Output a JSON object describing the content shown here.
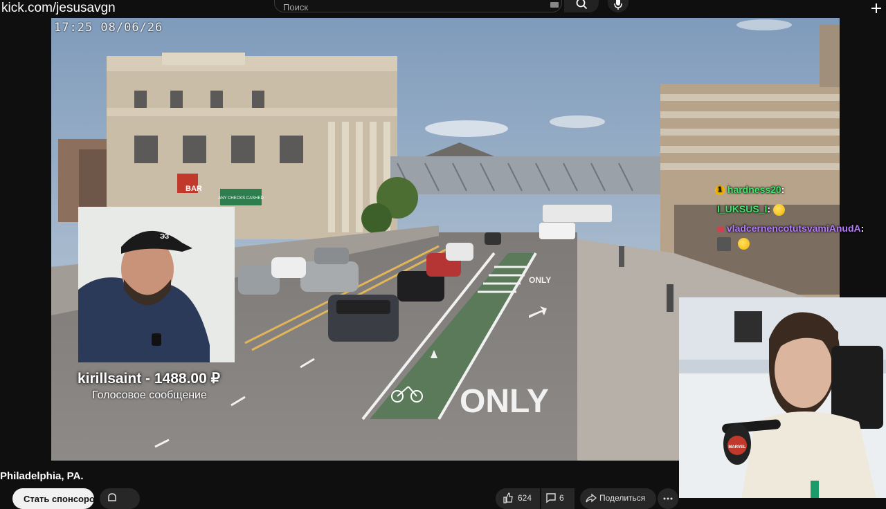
{
  "watermark": {
    "url": "kick.com/jesusavgn"
  },
  "header": {
    "search_placeholder": "Поиск",
    "icons": [
      "keyboard-icon",
      "search-icon",
      "mic-icon",
      "plus-icon"
    ]
  },
  "video": {
    "timestamp": "17:25 08/06/26",
    "signs": {
      "bar": "BAR",
      "checks": "ANY CHECKS CASHED",
      "road_only_near": "ONLY",
      "road_only_far": "ONLY"
    }
  },
  "donation": {
    "title": "kirillsaint - 1488.00 ₽",
    "subtitle": "Голосовое сообщение"
  },
  "chat": {
    "messages": [
      {
        "user": "hardness20",
        "text": "",
        "color": "#3ee86c",
        "badge": "1"
      },
      {
        "user": "I_UKSUS_I",
        "text": "",
        "color": "#3ee86c",
        "emote": "emoji-face"
      },
      {
        "user": "vladcernencotutsvamiAnudA",
        "text": "",
        "color": "#b57cff",
        "emote": "emoji-face"
      }
    ],
    "colon": ":"
  },
  "webcam": {
    "mic_brand_text": "MARVEL"
  },
  "footer": {
    "location": "Philadelphia, PA.",
    "subscribe_label": "Стать спонсором",
    "like_count": "624",
    "comment_count": "6",
    "share_label": "Поделиться"
  }
}
